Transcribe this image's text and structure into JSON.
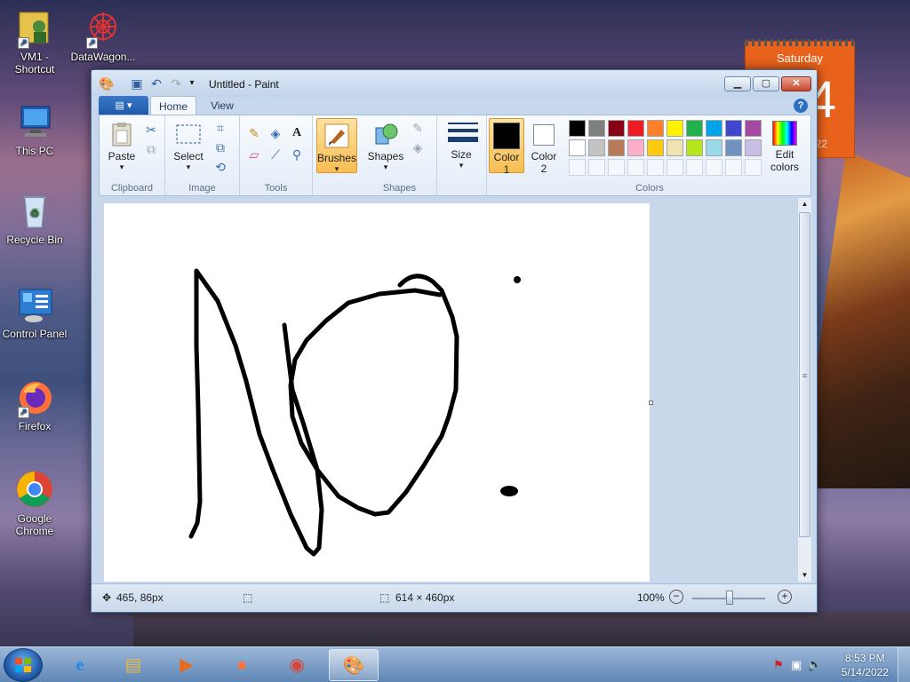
{
  "desktop": {
    "icons": [
      {
        "label": "VM1 -\nShortcut",
        "l1": "VM1 -",
        "l2": "Shortcut"
      },
      {
        "label": "DataWagon...",
        "l1": "DataWagon...",
        "l2": ""
      },
      {
        "label": "This PC",
        "l1": "This PC",
        "l2": ""
      },
      {
        "label": "Recycle Bin",
        "l1": "Recycle Bin",
        "l2": ""
      },
      {
        "label": "Control Panel",
        "l1": "Control Panel",
        "l2": ""
      },
      {
        "label": "Firefox",
        "l1": "Firefox",
        "l2": ""
      },
      {
        "label": "Google Chrome",
        "l1": "Google",
        "l2": "Chrome"
      }
    ],
    "calendar_gadget": {
      "day_name": "Saturday",
      "day_number": "14",
      "year_fragment": "22"
    }
  },
  "window": {
    "title": "Untitled - Paint",
    "tabs": {
      "file_label": "▤ ▾",
      "home": "Home",
      "view": "View"
    },
    "groups": {
      "clipboard": {
        "label": "Clipboard",
        "paste": "Paste"
      },
      "image": {
        "label": "Image",
        "select": "Select"
      },
      "tools": {
        "label": "Tools"
      },
      "brushes": {
        "label": "Brushes"
      },
      "shapes": {
        "label": "Shapes",
        "button": "Shapes"
      },
      "size": {
        "label": "Size"
      },
      "colors": {
        "label": "Colors",
        "color1": "Color",
        "color1_num": "1",
        "color2": "Color",
        "color2_num": "2",
        "edit": "Edit",
        "edit2": "colors"
      }
    },
    "palette_row1": [
      "#000000",
      "#7f7f7f",
      "#880015",
      "#ed1c24",
      "#ff7f27",
      "#fff200",
      "#22b14c",
      "#00a2e8",
      "#3f48cc",
      "#a349a4"
    ],
    "palette_row2": [
      "#ffffff",
      "#c3c3c3",
      "#b97a57",
      "#ffaec9",
      "#ffc90e",
      "#efe4b0",
      "#b5e61d",
      "#99d9ea",
      "#7092be",
      "#c8bfe7"
    ],
    "primary_color": "#000000",
    "secondary_color": "#ffffff",
    "status": {
      "cursor_pos": "465, 86px",
      "canvas_size": "614 × 460px",
      "zoom": "100%"
    }
  },
  "taskbar": {
    "time": "8:53 PM",
    "date": "5/14/2022"
  }
}
